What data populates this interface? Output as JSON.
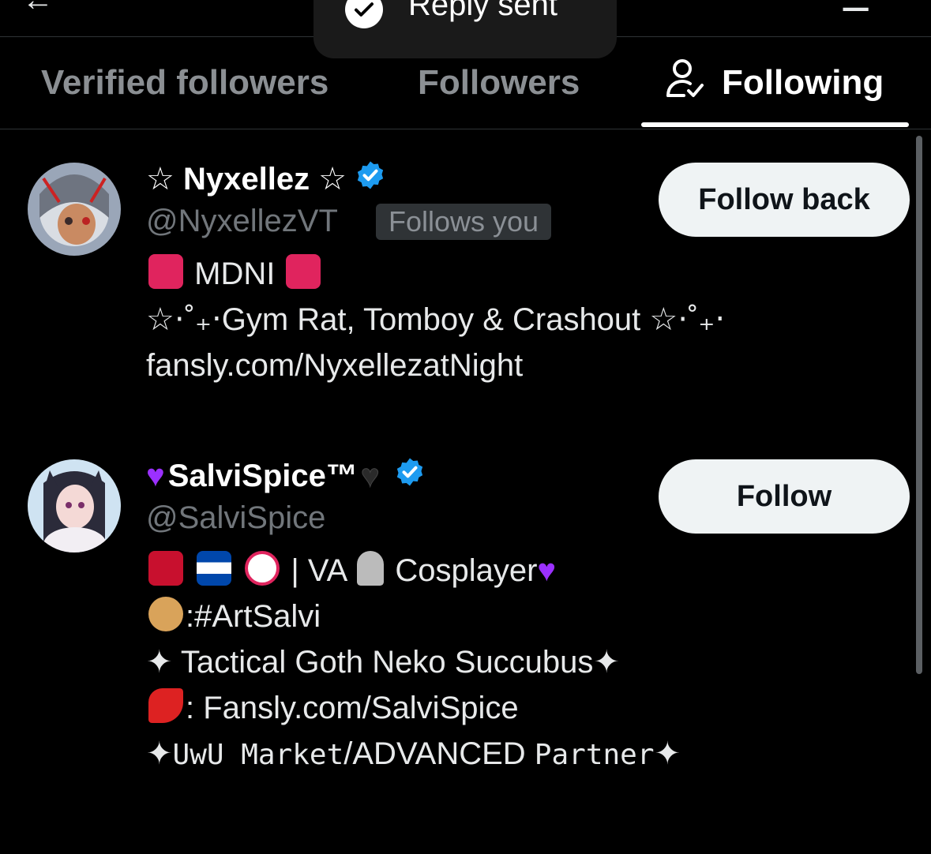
{
  "toast": {
    "text": "Reply sent"
  },
  "tabs": [
    {
      "label": "Verified followers"
    },
    {
      "label": "Followers"
    },
    {
      "label": "Following"
    }
  ],
  "accounts": [
    {
      "name": "☆ Nyxellez ☆",
      "handle": "@NyxellezVT",
      "follows_you": "Follows you",
      "button": "Follow back",
      "bio": {
        "line1": "MDNI",
        "line2": "☆⋅˚₊‧Gym Rat, Tomboy & Crashout ☆⋅˚₊‧",
        "line3": "fansly.com/NyxellezatNight"
      }
    },
    {
      "name": "SalviSpice™",
      "handle": "@SalviSpice",
      "button": "Follow",
      "bio": {
        "line1": "| VA",
        "line1b": "Cosplayer",
        "line2": ":#ArtSalvi",
        "line3": "✦ Tactical Goth Neko Succubus✦",
        "line4": ": Fansly.com/SalviSpice",
        "line5a": "✦",
        "line5b": "UwU Market",
        "line5c": "/ADVANCED ",
        "line5d": "Partner",
        "line5e": "✦"
      }
    }
  ],
  "colors": {
    "verified": "#1d9bf0",
    "button_bg": "#eff3f4",
    "siren": "#e0245e",
    "heart_purple": "#9b30ff"
  }
}
